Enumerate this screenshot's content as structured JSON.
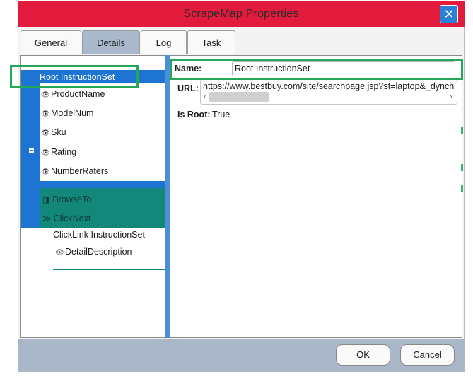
{
  "window": {
    "title": "ScrapeMap Properties",
    "close_symbol": "✕"
  },
  "tabs": [
    {
      "label": "General",
      "active": false
    },
    {
      "label": "Details",
      "active": true
    },
    {
      "label": "Log",
      "active": false
    },
    {
      "label": "Task",
      "active": false
    }
  ],
  "tree": {
    "root": "Root InstructionSet",
    "items": [
      {
        "label": "ProductName",
        "icon": "eye-icon"
      },
      {
        "label": "ModelNum",
        "icon": "eye-icon"
      },
      {
        "label": "Sku",
        "icon": "eye-icon"
      },
      {
        "label": "Rating",
        "icon": "eye-icon"
      },
      {
        "label": "NumberRaters",
        "icon": "eye-icon"
      }
    ],
    "actions": [
      {
        "label": "BrowseTo",
        "icon": "browse-icon"
      },
      {
        "label": "ClickNext",
        "icon": "double-chevron-icon"
      }
    ],
    "click_link": "ClickLink InstructionSet",
    "detail": {
      "label": "DetailDescription",
      "icon": "eye-icon"
    }
  },
  "properties": {
    "name_label": "Name:",
    "name_value": "Root InstructionSet",
    "url_label": "URL:",
    "url_value": "https://www.bestbuy.com/site/searchpage.jsp?st=laptop&_dynch",
    "is_root_label": "Is Root:",
    "is_root_value": "True"
  },
  "buttons": {
    "ok": "OK",
    "cancel": "Cancel"
  },
  "colors": {
    "titlebar": "#e21b3c",
    "selection": "#1e74d2",
    "teal": "#13877a",
    "highlight_box": "#23a85a"
  }
}
